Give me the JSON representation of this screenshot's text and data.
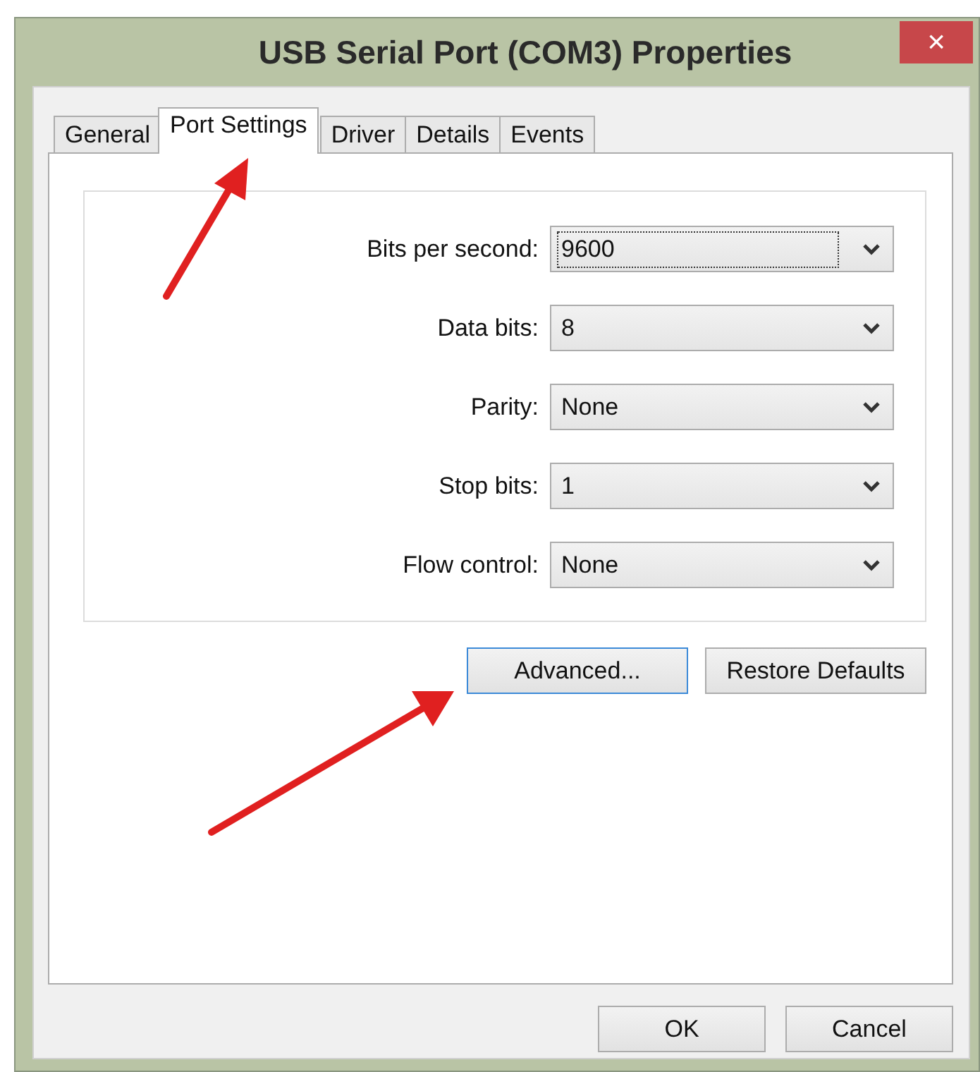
{
  "window": {
    "title": "USB Serial Port (COM3) Properties",
    "close": "×"
  },
  "tabs": [
    {
      "label": "General",
      "selected": false
    },
    {
      "label": "Port Settings",
      "selected": true
    },
    {
      "label": "Driver",
      "selected": false
    },
    {
      "label": "Details",
      "selected": false
    },
    {
      "label": "Events",
      "selected": false
    }
  ],
  "settings": [
    {
      "label": "Bits per second:",
      "value": "9600",
      "focused": true
    },
    {
      "label": "Data bits:",
      "value": "8",
      "focused": false
    },
    {
      "label": "Parity:",
      "value": "None",
      "focused": false
    },
    {
      "label": "Stop bits:",
      "value": "1",
      "focused": false
    },
    {
      "label": "Flow control:",
      "value": "None",
      "focused": false
    }
  ],
  "actions": [
    {
      "label": "Advanced...",
      "default": true
    },
    {
      "label": "Restore Defaults",
      "default": false
    }
  ],
  "buttons": [
    {
      "label": "OK",
      "default": false
    },
    {
      "label": "Cancel",
      "default": false
    }
  ]
}
